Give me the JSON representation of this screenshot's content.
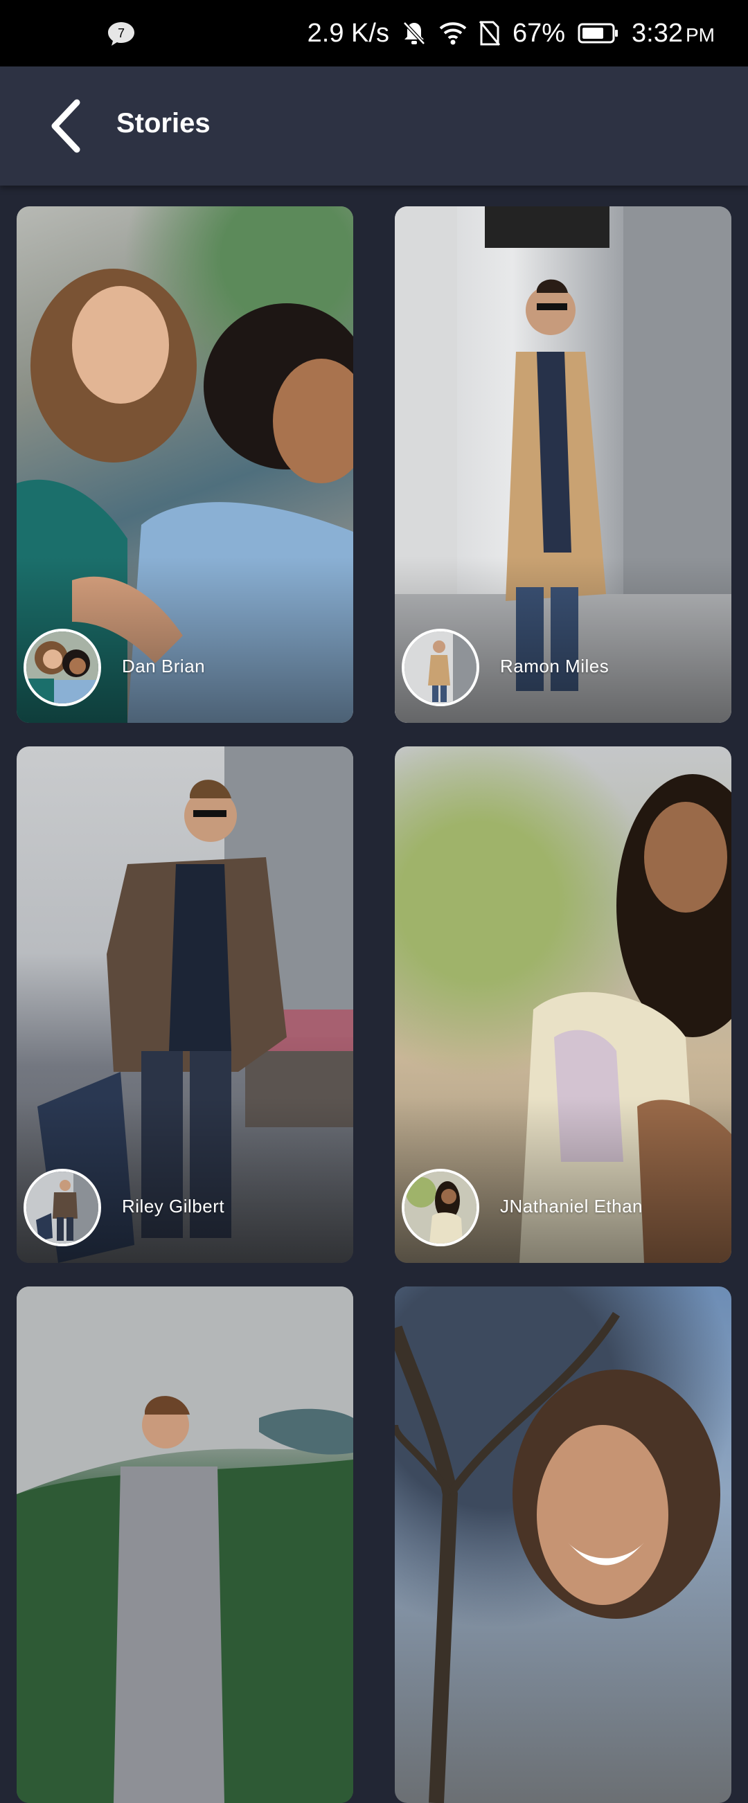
{
  "status_bar": {
    "notification_count": "7",
    "network_speed": "2.9 K/s",
    "battery_percent": "67%",
    "time": "3:32",
    "ampm": "PM"
  },
  "app_bar": {
    "title": "Stories"
  },
  "stories": [
    {
      "name": "Dan Brian"
    },
    {
      "name": "Ramon Miles"
    },
    {
      "name": "Riley Gilbert"
    },
    {
      "name": "JNathaniel Ethan"
    },
    {
      "name": ""
    },
    {
      "name": ""
    }
  ],
  "colors": {
    "background": "#222634",
    "app_bar": "#2d3243",
    "status_bar": "#000000",
    "text": "#ffffff"
  }
}
